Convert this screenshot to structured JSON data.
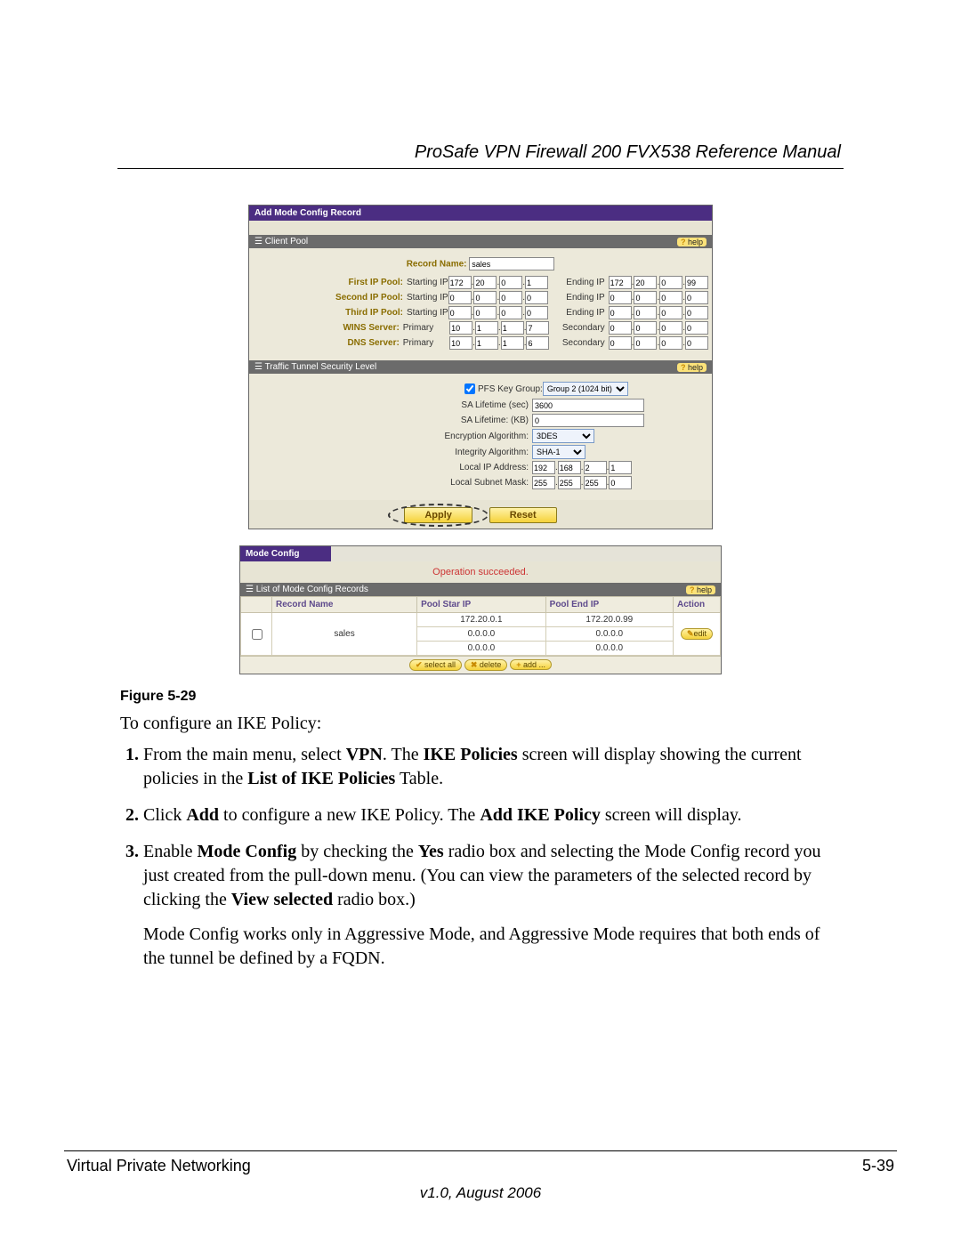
{
  "header": {
    "title": "ProSafe VPN Firewall 200 FVX538 Reference Manual"
  },
  "shot1": {
    "titlebar": "Add Mode Config Record",
    "section_client_pool": "Client Pool",
    "help": "help",
    "record_name_label": "Record Name:",
    "record_name_value": "sales",
    "rows": {
      "first": {
        "label": "First IP Pool:",
        "start": "Starting IP",
        "sip": [
          "172",
          "20",
          "0",
          "1"
        ],
        "end": "Ending IP",
        "eip": [
          "172",
          "20",
          "0",
          "99"
        ]
      },
      "second": {
        "label": "Second IP Pool:",
        "start": "Starting IP",
        "sip": [
          "0",
          "0",
          "0",
          "0"
        ],
        "end": "Ending IP",
        "eip": [
          "0",
          "0",
          "0",
          "0"
        ]
      },
      "third": {
        "label": "Third IP Pool:",
        "start": "Starting IP",
        "sip": [
          "0",
          "0",
          "0",
          "0"
        ],
        "end": "Ending IP",
        "eip": [
          "0",
          "0",
          "0",
          "0"
        ]
      },
      "wins": {
        "label": "WINS Server:",
        "start": "Primary",
        "sip": [
          "10",
          "1",
          "1",
          "7"
        ],
        "end": "Secondary",
        "eip": [
          "0",
          "0",
          "0",
          "0"
        ]
      },
      "dns": {
        "label": "DNS Server:",
        "start": "Primary",
        "sip": [
          "10",
          "1",
          "1",
          "6"
        ],
        "end": "Secondary",
        "eip": [
          "0",
          "0",
          "0",
          "0"
        ]
      }
    },
    "section_tunnel": "Traffic Tunnel Security Level",
    "tunnel": {
      "pfs_label": "PFS Key Group:",
      "pfs_value": "Group 2 (1024 bit)",
      "sa_sec_label": "SA Lifetime (sec)",
      "sa_sec_value": "3600",
      "sa_kb_label": "SA Lifetime: (KB)",
      "sa_kb_value": "0",
      "enc_label": "Encryption Algorithm:",
      "enc_value": "3DES",
      "int_label": "Integrity Algorithm:",
      "int_value": "SHA-1",
      "lip_label": "Local IP Address:",
      "lip": [
        "192",
        "168",
        "2",
        "1"
      ],
      "lsm_label": "Local Subnet Mask:",
      "lsm": [
        "255",
        "255",
        "255",
        "0"
      ]
    },
    "apply": "Apply",
    "reset": "Reset"
  },
  "shot2": {
    "titlebar": "Mode Config",
    "ok": "Operation succeeded.",
    "listbar": "List of Mode Config Records",
    "help": "help",
    "cols": {
      "name": "Record Name",
      "start": "Pool Star IP",
      "end": "Pool End IP",
      "action": "Action"
    },
    "row": {
      "name": "sales",
      "s1": "172.20.0.1",
      "e1": "172.20.0.99",
      "s2": "0.0.0.0",
      "e2": "0.0.0.0",
      "s3": "0.0.0.0",
      "e3": "0.0.0.0",
      "edit": "edit"
    },
    "btns": {
      "selectall": "select all",
      "delete": "delete",
      "add": "add ..."
    }
  },
  "caption": "Figure 5-29",
  "intro": "To configure an IKE Policy:",
  "steps": {
    "s1a": "From the main menu, select ",
    "s1b": "VPN",
    "s1c": ". The ",
    "s1d": "IKE Policies",
    "s1e": " screen will display showing the current policies in the ",
    "s1f": "List of IKE Policies",
    "s1g": " Table.",
    "s2a": "Click ",
    "s2b": "Add",
    "s2c": " to configure a new IKE Policy. The ",
    "s2d": "Add IKE Policy",
    "s2e": " screen will display.",
    "s3a": "Enable ",
    "s3b": "Mode Config",
    "s3c": " by checking the ",
    "s3d": "Yes",
    "s3e": " radio box and selecting the Mode Config record you just created from the pull-down menu. (You can view the parameters of the selected record by clicking the ",
    "s3f": "View selected",
    "s3g": " radio box.)",
    "s3note": "Mode Config works only in Aggressive Mode, and Aggressive Mode requires that both ends of the tunnel be defined by a FQDN."
  },
  "footer": {
    "left": "Virtual Private Networking",
    "right": "5-39",
    "version": "v1.0, August 2006"
  }
}
